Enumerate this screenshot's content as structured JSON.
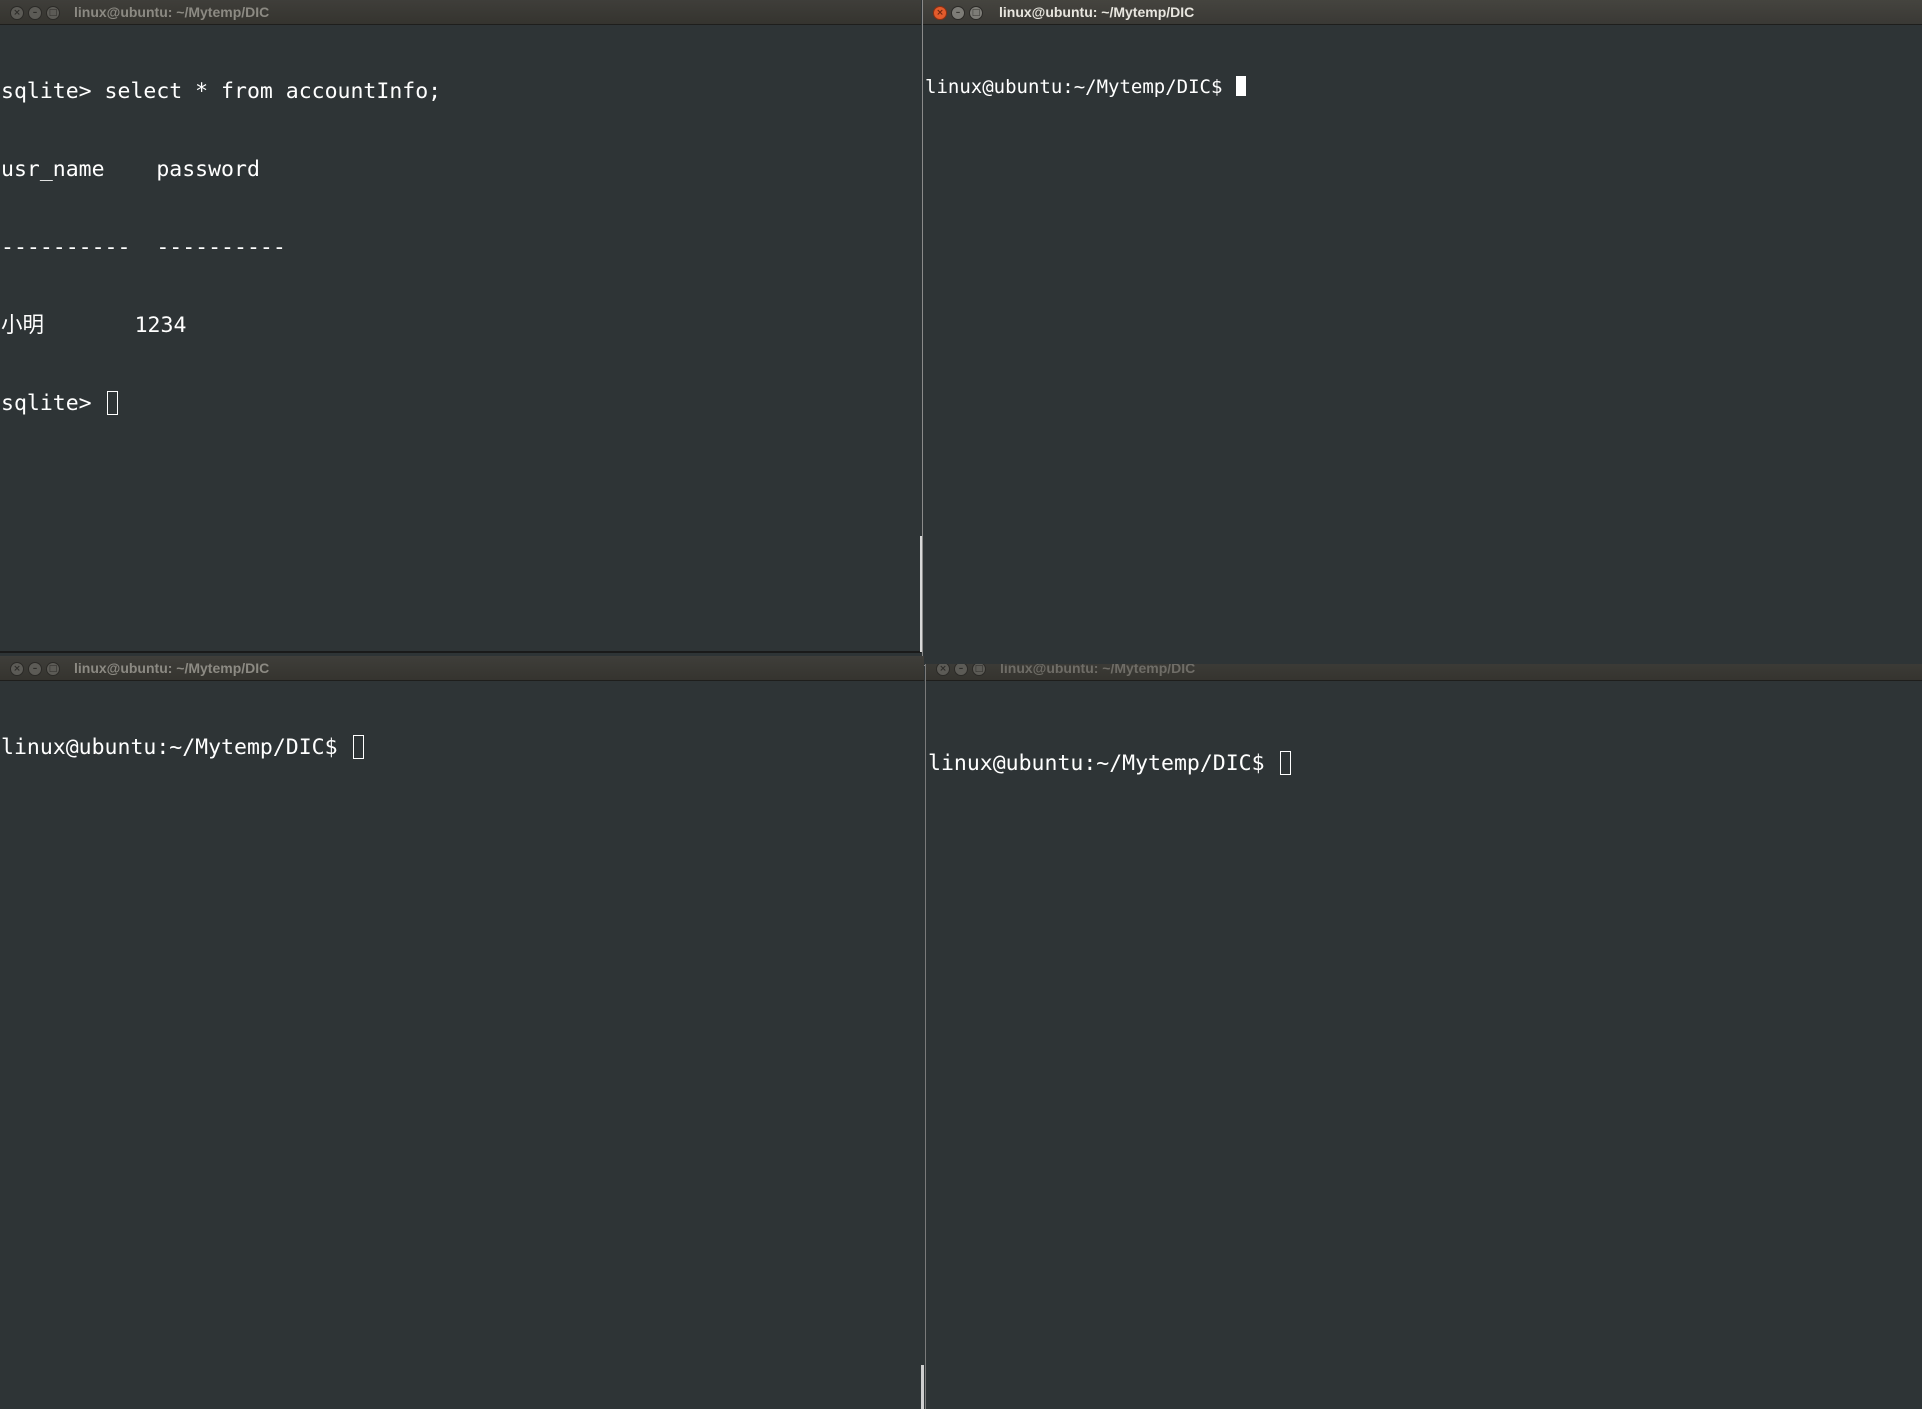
{
  "windows": {
    "top_left": {
      "title": "linux@ubuntu: ~/Mytemp/DIC",
      "lines": [
        "sqlite> select * from accountInfo;",
        "usr_name    password",
        "----------  ----------",
        "小明       1234"
      ],
      "prompt": "sqlite> "
    },
    "top_right": {
      "title": "linux@ubuntu: ~/Mytemp/DIC",
      "prompt": "linux@ubuntu:~/Mytemp/DIC$ "
    },
    "bottom_left": {
      "title": "linux@ubuntu: ~/Mytemp/DIC",
      "prompt": "linux@ubuntu:~/Mytemp/DIC$ "
    },
    "bottom_right": {
      "title": "linux@ubuntu: ~/Mytemp/DIC",
      "prompt": "linux@ubuntu:~/Mytemp/DIC$ "
    }
  },
  "window_buttons": {
    "close": "×",
    "minimize": "–",
    "maximize": "□"
  },
  "icons": {
    "close": "close-icon",
    "minimize": "minimize-icon",
    "maximize": "maximize-icon"
  },
  "colors": {
    "terminal_bg": "#2e3436",
    "terminal_fg": "#ffffff",
    "titlebar_bg": "#3c3b37",
    "close_active": "#e25b2c"
  }
}
